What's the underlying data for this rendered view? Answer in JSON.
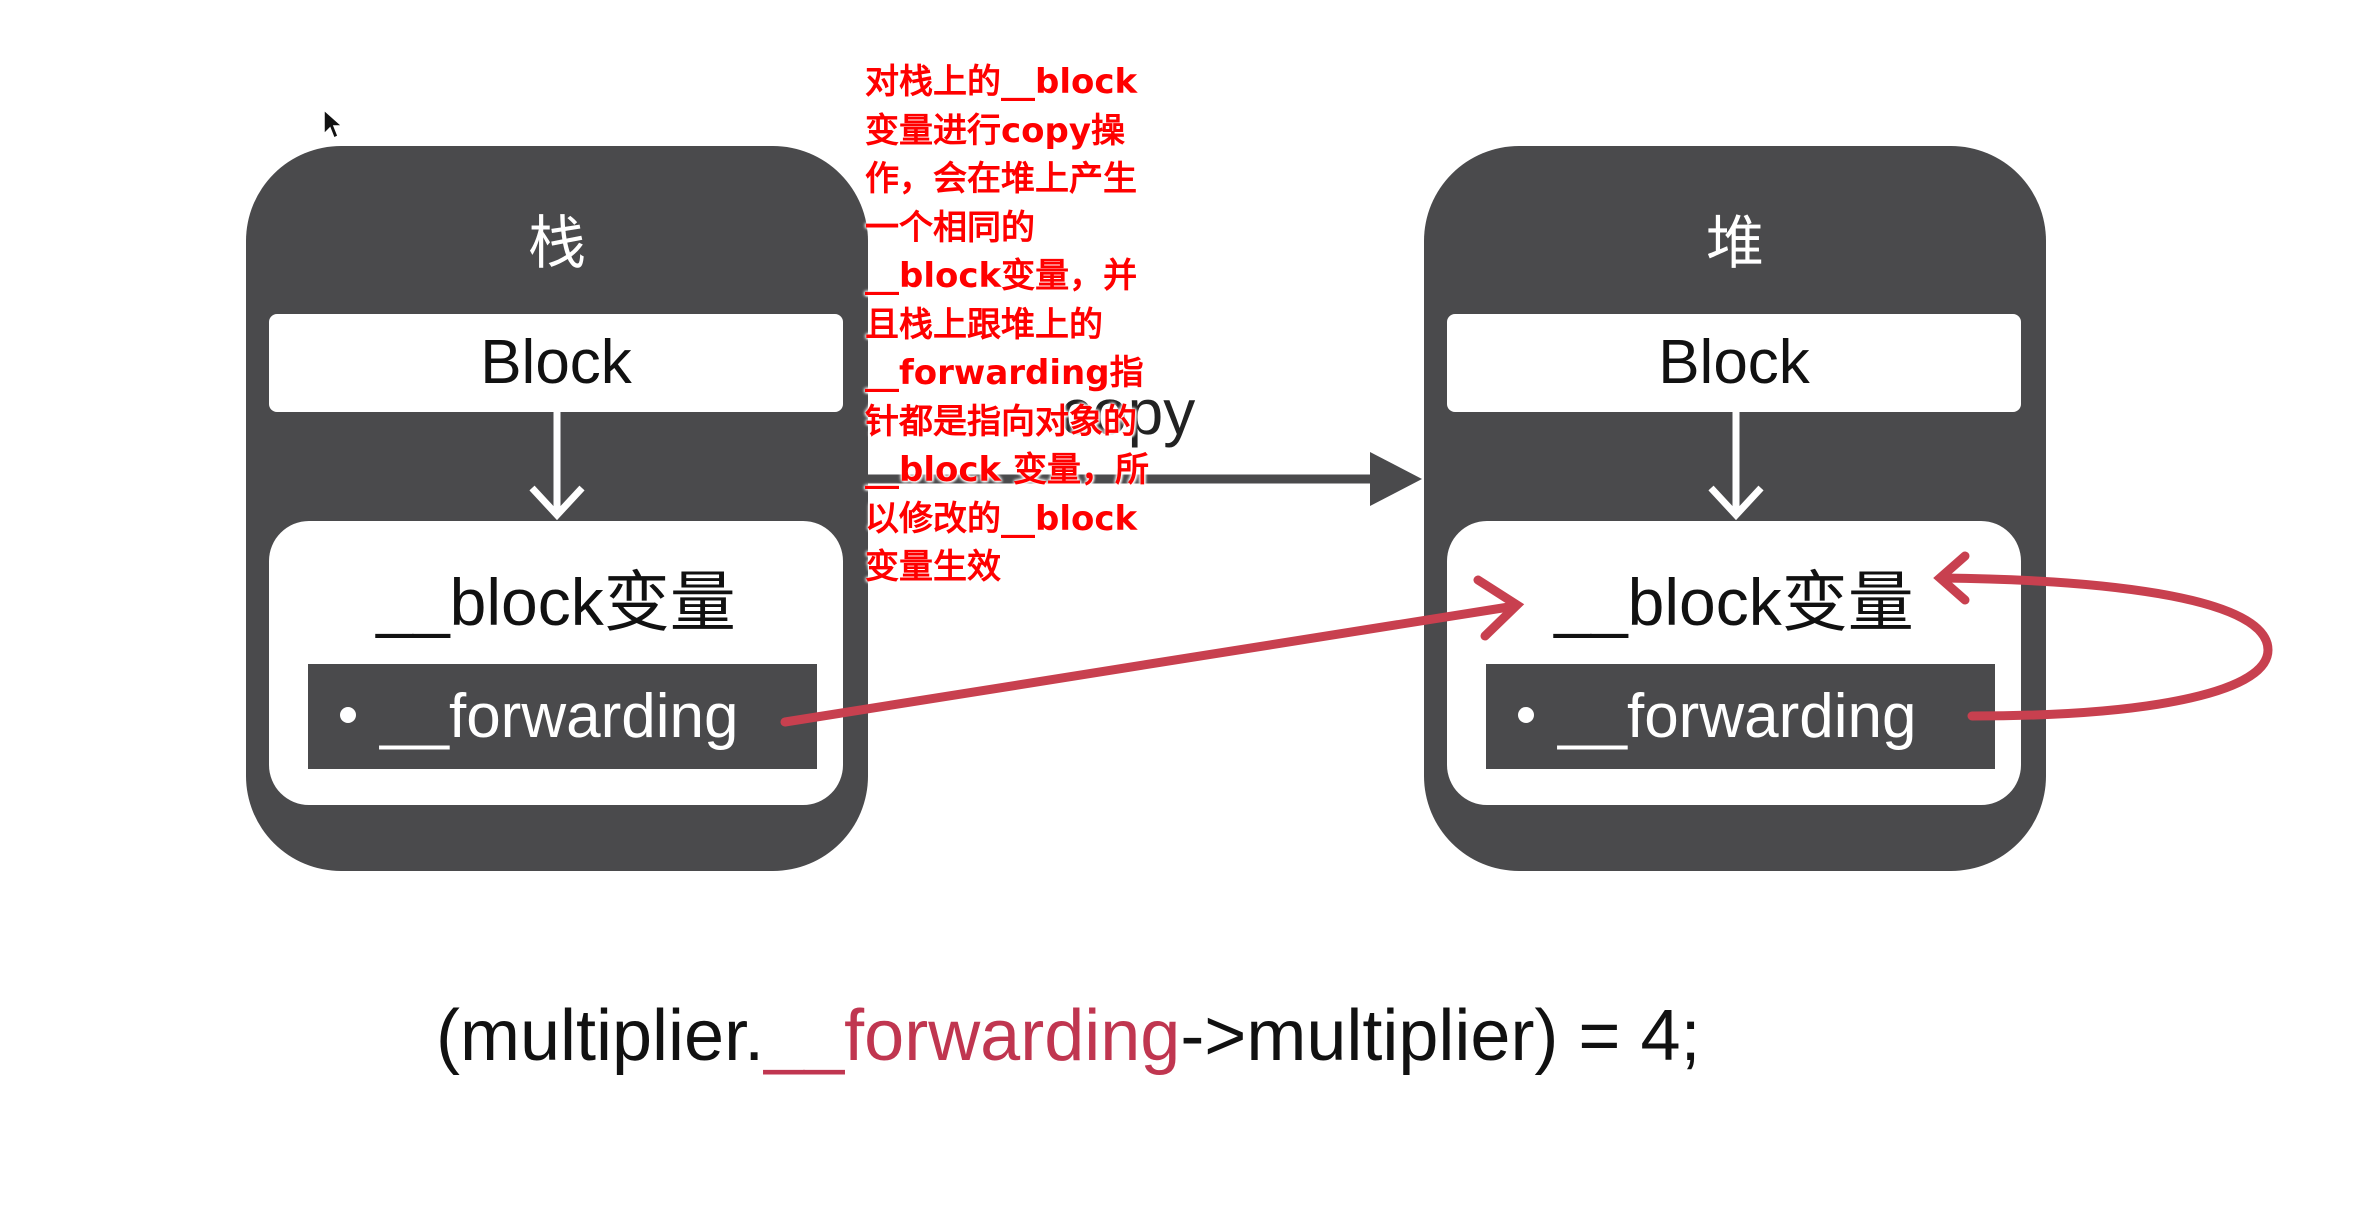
{
  "stack": {
    "title": "栈",
    "block_label": "Block",
    "var_label": "__block变量",
    "forwarding_label": "__forwarding"
  },
  "heap": {
    "title": "堆",
    "block_label": "Block",
    "var_label": "__block变量",
    "forwarding_label": "__forwarding"
  },
  "copy_label": "copy",
  "annotation_lines": [
    "对栈上的__block",
    "变量进行copy操",
    "作，会在堆上产生",
    "一个相同的",
    "__block变量，并",
    "且栈上跟堆上的",
    "__forwarding指",
    "针都是指向对象的",
    "__block 变量，所",
    "以修改的__block",
    "变量生效"
  ],
  "formula": {
    "prefix": "(multiplier.",
    "highlight": "__forwarding",
    "suffix": "->multiplier) = 4;"
  },
  "colors": {
    "box": "#4a4a4c",
    "pointer": "#c8404f",
    "annotation": "#ff0000"
  }
}
